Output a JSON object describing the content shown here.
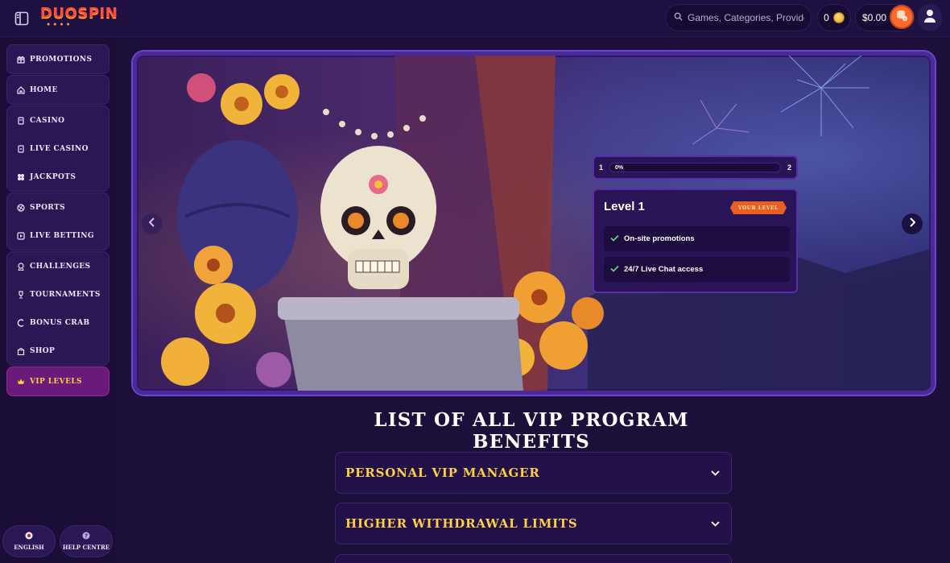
{
  "header": {
    "logo_text": "DUOSPIN",
    "search_placeholder": "Games, Categories, Providers",
    "coins_count": "0",
    "balance": "$0.00"
  },
  "sidebar": {
    "groups": [
      [
        "PROMOTIONS"
      ],
      [
        "HOME"
      ],
      [
        "CASINO",
        "LIVE CASINO",
        "JACKPOTS"
      ],
      [
        "SPORTS",
        "LIVE BETTING"
      ],
      [
        "CHALLENGES",
        "TOURNAMENTS",
        "BONUS CRAB",
        "SHOP"
      ],
      [
        "VIP LEVELS"
      ]
    ],
    "language": "ENGLISH",
    "help": "HELP CENTRE"
  },
  "banner": {
    "progress_from": "1",
    "progress_to": "2",
    "progress_percent": "0%",
    "progress_value": 0,
    "level_title": "Level 1",
    "your_level_badge": "YOUR LEVEL",
    "benefits": [
      "On-site promotions",
      "24/7 Live Chat access"
    ]
  },
  "benefits_section": {
    "title": "LIST OF ALL VIP PROGRAM BENEFITS",
    "items": [
      "PERSONAL VIP MANAGER",
      "HIGHER WITHDRAWAL LIMITS",
      ""
    ]
  },
  "colors": {
    "accent_gold": "#ffcf44",
    "accent_orange": "#e85f22",
    "panel": "#2a1458",
    "active_nav": "#6a1b7a"
  }
}
